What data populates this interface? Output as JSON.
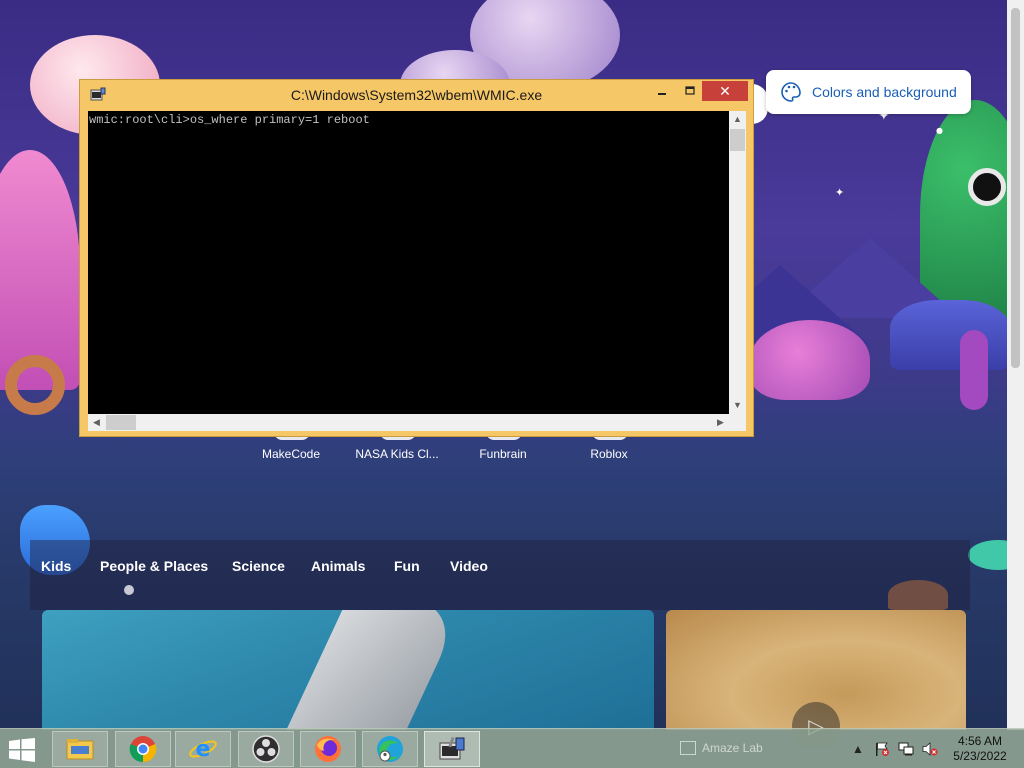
{
  "console": {
    "title": "C:\\Windows\\System32\\wbem\\WMIC.exe",
    "output": "wmic:root\\cli>os_where primary=1 reboot",
    "minimize_glyph": "▭",
    "maximize_glyph": "□",
    "close_glyph": "✕"
  },
  "browser": {
    "colors_button_label": "Colors and background",
    "quick_links": [
      {
        "label": "MakeCode"
      },
      {
        "label": "NASA Kids Cl..."
      },
      {
        "label": "Funbrain"
      },
      {
        "label": "Roblox"
      }
    ],
    "categories": [
      "Kids",
      "People & Places",
      "Science",
      "Animals",
      "Fun",
      "Video"
    ],
    "play_glyph": "▷"
  },
  "taskbar": {
    "apps": [
      {
        "name": "file-explorer"
      },
      {
        "name": "chrome"
      },
      {
        "name": "internet-explorer"
      },
      {
        "name": "obs-studio"
      },
      {
        "name": "firefox"
      },
      {
        "name": "edge"
      },
      {
        "name": "wmic-console"
      }
    ],
    "tray_watermark": "Amaze Lab",
    "clock_time": "4:56 AM",
    "clock_date": "5/23/2022"
  },
  "colors": {
    "console_frame": "#f6c766",
    "close_button": "#c7413a",
    "link_blue": "#1a5fb4"
  }
}
